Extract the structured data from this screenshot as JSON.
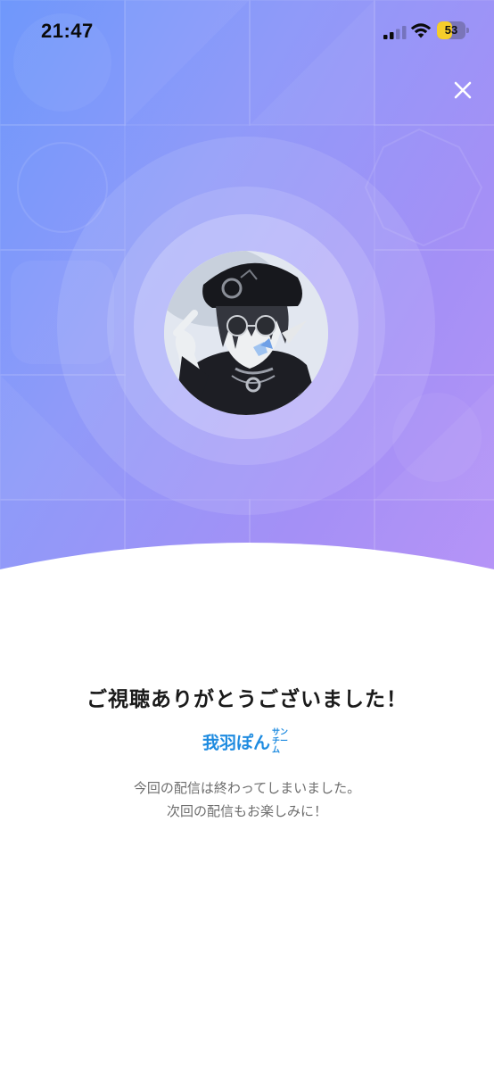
{
  "status_bar": {
    "time": "21:47",
    "battery_level": "53",
    "battery_fraction": 0.53,
    "signal_bars_active": 2,
    "signal_bars_total": 4
  },
  "header": {
    "close_icon": "close-icon"
  },
  "hero": {
    "gradient_start": "#6f98fb",
    "gradient_end": "#b894f7",
    "avatar_icon": "streamer-avatar"
  },
  "main": {
    "title": "ご視聴ありがとうございました！",
    "streamer_name": "我羽ぽん",
    "streamer_suffix_top": "サン",
    "streamer_suffix_bottom": "チーム",
    "message_line1": "今回の配信は終わってしまいました。",
    "message_line2": "次回の配信もお楽しみに！"
  },
  "colors": {
    "accent": "#1e8be0",
    "text_primary": "#1a1a1a",
    "text_secondary": "#6e6e6e",
    "battery": "#f6cd2b"
  }
}
